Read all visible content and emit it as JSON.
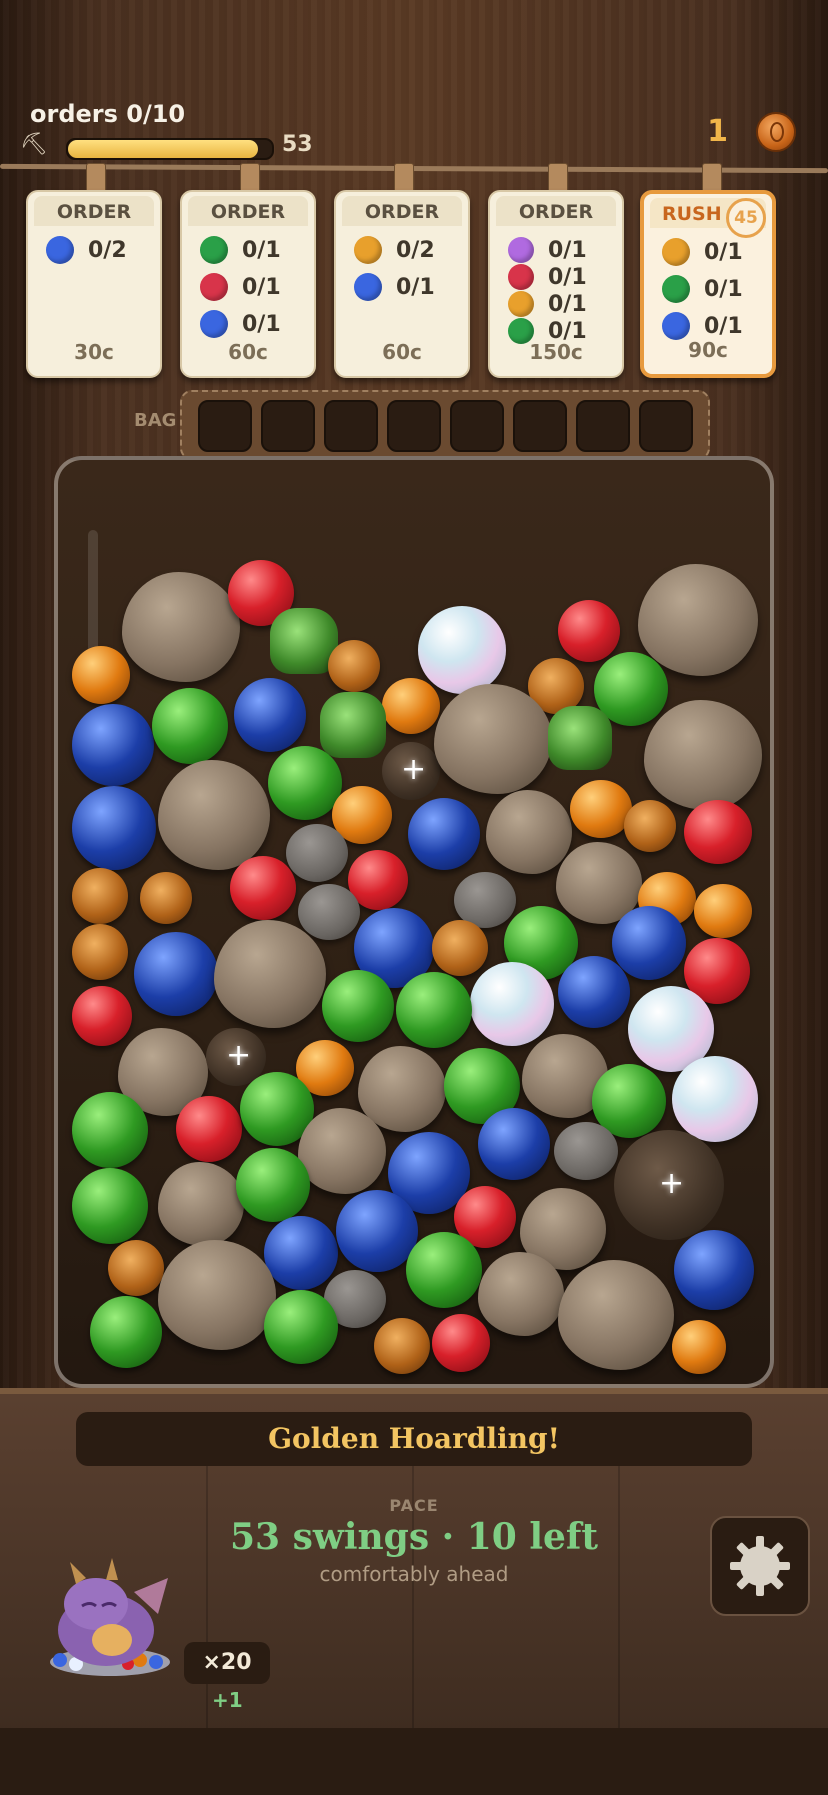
{
  "hud": {
    "orders_label": "orders 0/10",
    "swings_progress": 0.93,
    "swings_count": "53",
    "coins": "1"
  },
  "orders": [
    {
      "head": "ORDER",
      "rows": [
        {
          "color": "#3a66e0",
          "text": "0/2"
        }
      ],
      "price": "30c"
    },
    {
      "head": "ORDER",
      "rows": [
        {
          "color": "#2aa048",
          "text": "0/1"
        },
        {
          "color": "#d8344a",
          "text": "0/1"
        },
        {
          "color": "#3a66e0",
          "text": "0/1"
        }
      ],
      "price": "60c"
    },
    {
      "head": "ORDER",
      "rows": [
        {
          "color": "#e8a02c",
          "text": "0/2"
        },
        {
          "color": "#3a66e0",
          "text": "0/1"
        }
      ],
      "price": "60c"
    },
    {
      "head": "ORDER",
      "rows": [
        {
          "color": "#b06ae0",
          "text": "0/1"
        },
        {
          "color": "#d8344a",
          "text": "0/1"
        },
        {
          "color": "#e8a02c",
          "text": "0/1"
        },
        {
          "color": "#2aa048",
          "text": "0/1"
        }
      ],
      "price": "150c"
    },
    {
      "head": "RUSH",
      "timer": "45",
      "rows": [
        {
          "color": "#e8a02c",
          "text": "0/1"
        },
        {
          "color": "#2aa048",
          "text": "0/1"
        },
        {
          "color": "#3a66e0",
          "text": "0/1"
        }
      ],
      "price": "90c"
    }
  ],
  "bag": {
    "label": "BAG",
    "slots": 8
  },
  "panel": {
    "banner": "Golden Hoardling!",
    "pace_label": "PACE",
    "pace_main": "53 swings · 10 left",
    "pace_sub": "comfortably ahead",
    "multiplier": "×20",
    "bonus": "+1"
  },
  "icons": {
    "pick": "pickaxe-icon",
    "coin": "coin-icon",
    "settings": "gear-icon",
    "pet": "dragon-icon"
  },
  "colors": {
    "accent_gold": "#f3c562",
    "pace_green": "#7fce84",
    "rush_orange": "#e79a3e"
  }
}
